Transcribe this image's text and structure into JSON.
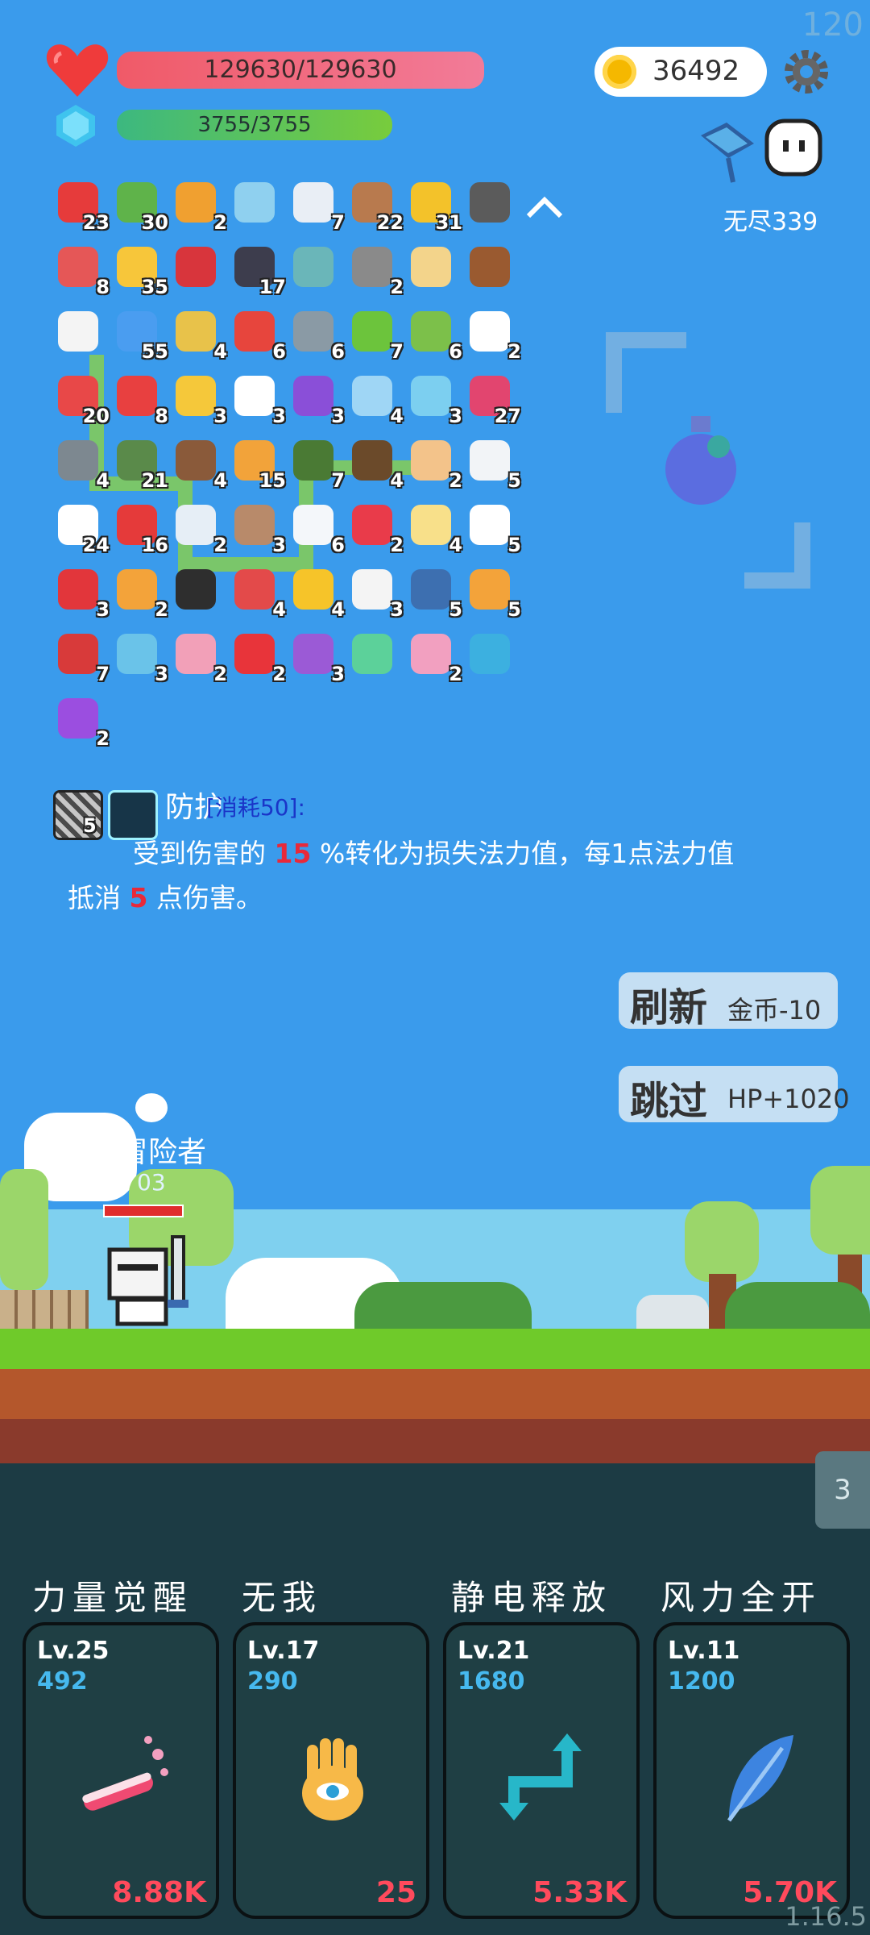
{
  "fps": "120",
  "version": "1.16.5",
  "hp": {
    "text": "129630/129630"
  },
  "mp": {
    "text": "3755/3755"
  },
  "coins": "36492",
  "mode_label": "无尽339",
  "items": [
    {
      "icon": "sock-icon",
      "count": "23",
      "color": "#e63b3b"
    },
    {
      "icon": "money-heart-icon",
      "count": "30",
      "color": "#5fb34a"
    },
    {
      "icon": "torch-icon",
      "count": "2",
      "color": "#f0a030"
    },
    {
      "icon": "magnifier-icon",
      "count": "",
      "color": "#8fd0ef"
    },
    {
      "icon": "eraser-icon",
      "count": "7",
      "color": "#e9eef5"
    },
    {
      "icon": "target-icon",
      "count": "22",
      "color": "#b87a4e"
    },
    {
      "icon": "crown-icon",
      "count": "31",
      "color": "#f3c22a"
    },
    {
      "icon": "mortar-icon",
      "count": "",
      "color": "#5b5b5b"
    },
    {
      "icon": "pill-icon",
      "count": "8",
      "color": "#e55757"
    },
    {
      "icon": "sun-icon",
      "count": "35",
      "color": "#f7c63a"
    },
    {
      "icon": "magnet-icon",
      "count": "",
      "color": "#d8353c"
    },
    {
      "icon": "bat-icon",
      "count": "17",
      "color": "#3d3d4d"
    },
    {
      "icon": "ring-target-icon",
      "count": "",
      "color": "#6ab6b9"
    },
    {
      "icon": "mace-icon",
      "count": "2",
      "color": "#8a8a8a"
    },
    {
      "icon": "treasure-map-icon",
      "count": "",
      "color": "#f3d48b"
    },
    {
      "icon": "treasure-chest-icon",
      "count": "",
      "color": "#9a5a30"
    },
    {
      "icon": "playing-card-icon",
      "count": "",
      "color": "#f4f4f4"
    },
    {
      "icon": "star-card-icon",
      "count": "55",
      "color": "#4a9df0"
    },
    {
      "icon": "diamond-ring-icon",
      "count": "4",
      "color": "#e8c24a"
    },
    {
      "icon": "gift-icon",
      "count": "6",
      "color": "#e7453d"
    },
    {
      "icon": "compass-icon",
      "count": "6",
      "color": "#8a9aa5"
    },
    {
      "icon": "lime-icon",
      "count": "7",
      "color": "#6cc43c"
    },
    {
      "icon": "zombie-icon",
      "count": "6",
      "color": "#7cc04a"
    },
    {
      "icon": "speech-bubble-icon",
      "count": "2",
      "color": "#ffffff"
    },
    {
      "icon": "watermelon-icon",
      "count": "20",
      "color": "#e84848"
    },
    {
      "icon": "mushroom-icon",
      "count": "8",
      "color": "#e84040"
    },
    {
      "icon": "magic-wand-icon",
      "count": "3",
      "color": "#f5c83a"
    },
    {
      "icon": "ghost-icon",
      "count": "3",
      "color": "#ffffff"
    },
    {
      "icon": "star-box-icon",
      "count": "3",
      "color": "#8a4fd8"
    },
    {
      "icon": "halo-icon",
      "count": "4",
      "color": "#9fd6f5"
    },
    {
      "icon": "potion-flask-icon",
      "count": "3",
      "color": "#7ccff0"
    },
    {
      "icon": "jam-jar-icon",
      "count": "27",
      "color": "#e2456f"
    },
    {
      "icon": "battle-axe-icon",
      "count": "4",
      "color": "#7d8890"
    },
    {
      "icon": "sword-icon",
      "count": "21",
      "color": "#5a8a4a"
    },
    {
      "icon": "cake-icon",
      "count": "4",
      "color": "#8a5a3a"
    },
    {
      "icon": "book-icon",
      "count": "15",
      "color": "#f2a33a"
    },
    {
      "icon": "grenade-icon",
      "count": "7",
      "color": "#4a7a34"
    },
    {
      "icon": "coconut-icon",
      "count": "4",
      "color": "#6b4a2a"
    },
    {
      "icon": "glove-icon",
      "count": "2",
      "color": "#f3c38a"
    },
    {
      "icon": "envelope-icon",
      "count": "5",
      "color": "#f2f4f7"
    },
    {
      "icon": "flower-icon",
      "count": "24",
      "color": "#ffffff"
    },
    {
      "icon": "apple-icon",
      "count": "16",
      "color": "#e53a3a"
    },
    {
      "icon": "lightbulb-icon",
      "count": "2",
      "color": "#e6eef6"
    },
    {
      "icon": "door-icon",
      "count": "3",
      "color": "#b88a6a"
    },
    {
      "icon": "cloud-icon",
      "count": "6",
      "color": "#f4f7fa"
    },
    {
      "icon": "heart-icon",
      "count": "2",
      "color": "#e93b4a"
    },
    {
      "icon": "note-pencil-icon",
      "count": "4",
      "color": "#f8e08a"
    },
    {
      "icon": "fried-egg-icon",
      "count": "5",
      "color": "#ffffff"
    },
    {
      "icon": "strawberry-icon",
      "count": "3",
      "color": "#e2363b"
    },
    {
      "icon": "scroll-icon",
      "count": "2",
      "color": "#f3a33a"
    },
    {
      "icon": "cauldron-icon",
      "count": "",
      "color": "#2e2e2e"
    },
    {
      "icon": "shield-badge-icon",
      "count": "4",
      "color": "#e34a4a"
    },
    {
      "icon": "sunflower-icon",
      "count": "4",
      "color": "#f6c429"
    },
    {
      "icon": "dice-icon",
      "count": "3",
      "color": "#f4f4f4"
    },
    {
      "icon": "shield-icon",
      "count": "5",
      "color": "#3d6fb0"
    },
    {
      "icon": "meteors-icon",
      "count": "5",
      "color": "#f3a33a"
    },
    {
      "icon": "red-potion-icon",
      "count": "7",
      "color": "#d83a3a"
    },
    {
      "icon": "blue-scroll-icon",
      "count": "3",
      "color": "#6ac3e9"
    },
    {
      "icon": "perfume-icon",
      "count": "2",
      "color": "#f2a0b8"
    },
    {
      "icon": "bookmark-icon",
      "count": "2",
      "color": "#e8343a"
    },
    {
      "icon": "purple-shield-icon",
      "count": "3",
      "color": "#9b5ad6"
    },
    {
      "icon": "green-spirit-icon",
      "count": "",
      "color": "#5cd19a"
    },
    {
      "icon": "ice-cream-icon",
      "count": "2",
      "color": "#f2a0c0"
    },
    {
      "icon": "chat-bubbles-icon",
      "count": "",
      "color": "#3cb0e0"
    },
    {
      "icon": "crystal-ball-icon",
      "count": "2",
      "color": "#9b4ee0"
    }
  ],
  "effect": {
    "slot_count": "5",
    "title": "防护",
    "cost": "[消耗50]:",
    "line1_pre": "受到伤害的",
    "line1_num": "15",
    "line1_post": "%转化为损失法力值，每1点法力值",
    "line2_pre": "抵消",
    "line2_num": "5",
    "line2_post": "点伤害。"
  },
  "buttons": {
    "refresh": {
      "label": "刷新",
      "sub": "金币-10"
    },
    "skip": {
      "label": "跳过",
      "sub": "HP+1020"
    }
  },
  "hero": {
    "name": "冒险者",
    "level_partial": "03"
  },
  "side_badge": "3",
  "skills": [
    {
      "name": "力量觉醒",
      "lv": "Lv.25",
      "cost": "492",
      "value": "8.88K",
      "icon": "test-tube-icon"
    },
    {
      "name": "无我",
      "lv": "Lv.17",
      "cost": "290",
      "value": "25",
      "icon": "eye-hand-icon"
    },
    {
      "name": "静电释放",
      "lv": "Lv.21",
      "cost": "1680",
      "value": "5.33K",
      "icon": "exchange-arrows-icon"
    },
    {
      "name": "风力全开",
      "lv": "Lv.11",
      "cost": "1200",
      "value": "5.70K",
      "icon": "feather-icon"
    }
  ]
}
